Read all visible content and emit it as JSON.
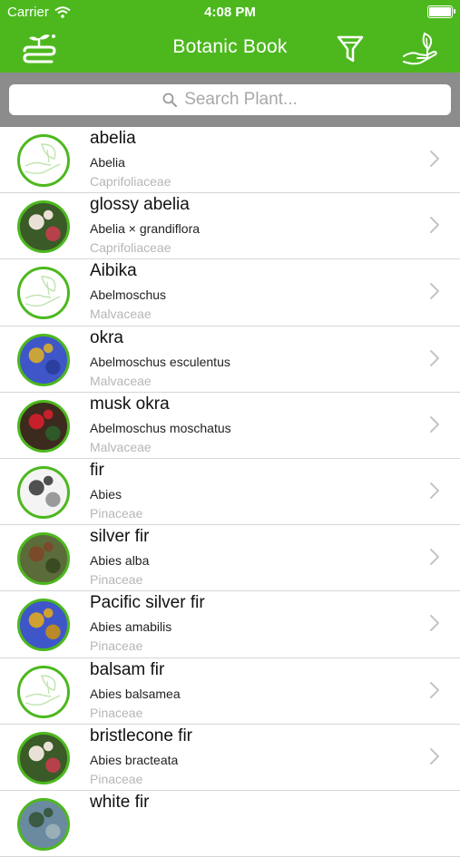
{
  "status": {
    "carrier": "Carrier",
    "time": "4:08 PM",
    "battery_level": 1.0
  },
  "nav": {
    "title": "Botanic Book",
    "left_icon": "plant-book-icon",
    "filter_icon": "filter-icon",
    "right_icon": "hand-leaf-icon"
  },
  "search": {
    "placeholder": "Search Plant..."
  },
  "colors": {
    "accent": "#4db81e",
    "search_bar_bg": "#8c8c8c",
    "family_text": "#b6b6b6"
  },
  "plants": [
    {
      "name": "abelia",
      "scientific": "Abelia",
      "family": "Caprifoliaceae",
      "image": "placeholder"
    },
    {
      "name": "glossy abelia",
      "scientific": "Abelia × grandiflora",
      "family": "Caprifoliaceae",
      "image": "photo"
    },
    {
      "name": "Aibika",
      "scientific": "Abelmoschus",
      "family": "Malvaceae",
      "image": "placeholder"
    },
    {
      "name": "okra",
      "scientific": "Abelmoschus esculentus",
      "family": "Malvaceae",
      "image": "photo"
    },
    {
      "name": "musk okra",
      "scientific": "Abelmoschus moschatus",
      "family": "Malvaceae",
      "image": "photo"
    },
    {
      "name": "fir",
      "scientific": "Abies",
      "family": "Pinaceae",
      "image": "photo"
    },
    {
      "name": "silver fir",
      "scientific": "Abies alba",
      "family": "Pinaceae",
      "image": "photo"
    },
    {
      "name": "Pacific silver fir",
      "scientific": "Abies amabilis",
      "family": "Pinaceae",
      "image": "photo"
    },
    {
      "name": "balsam fir",
      "scientific": "Abies balsamea",
      "family": "Pinaceae",
      "image": "placeholder"
    },
    {
      "name": "bristlecone fir",
      "scientific": "Abies bracteata",
      "family": "Pinaceae",
      "image": "photo"
    },
    {
      "name": "white fir",
      "scientific": "",
      "family": "",
      "image": "photo"
    }
  ]
}
